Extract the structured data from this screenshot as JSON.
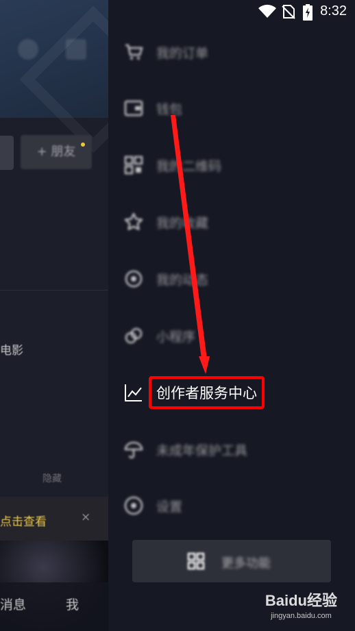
{
  "status_bar": {
    "time": "8:32"
  },
  "background": {
    "friend_button": "+ 朋友",
    "movie_text": "电影",
    "hint_text": "点击查看",
    "nav_label_left": "消息",
    "nav_label_right": "我",
    "small_text": "隐藏"
  },
  "drawer": {
    "items": [
      {
        "label": "我的订单",
        "icon": "cart-icon"
      },
      {
        "label": "钱包",
        "icon": "wallet-icon"
      },
      {
        "label": "我的二维码",
        "icon": "qrcode-icon"
      },
      {
        "label": "我的收藏",
        "icon": "star-icon"
      },
      {
        "label": "我的动态",
        "icon": "activity-icon"
      },
      {
        "label": "小程序",
        "icon": "miniprogram-icon"
      },
      {
        "label": "创作者服务中心",
        "icon": "chart-icon"
      },
      {
        "label": "未成年保护工具",
        "icon": "umbrella-icon"
      },
      {
        "label": "设置",
        "icon": "settings-icon"
      }
    ],
    "more_button": "更多功能"
  },
  "annotation": {
    "highlight_color": "#ff0000"
  },
  "watermark": {
    "brand": "Baidu经验",
    "url": "jingyan.baidu.com"
  }
}
